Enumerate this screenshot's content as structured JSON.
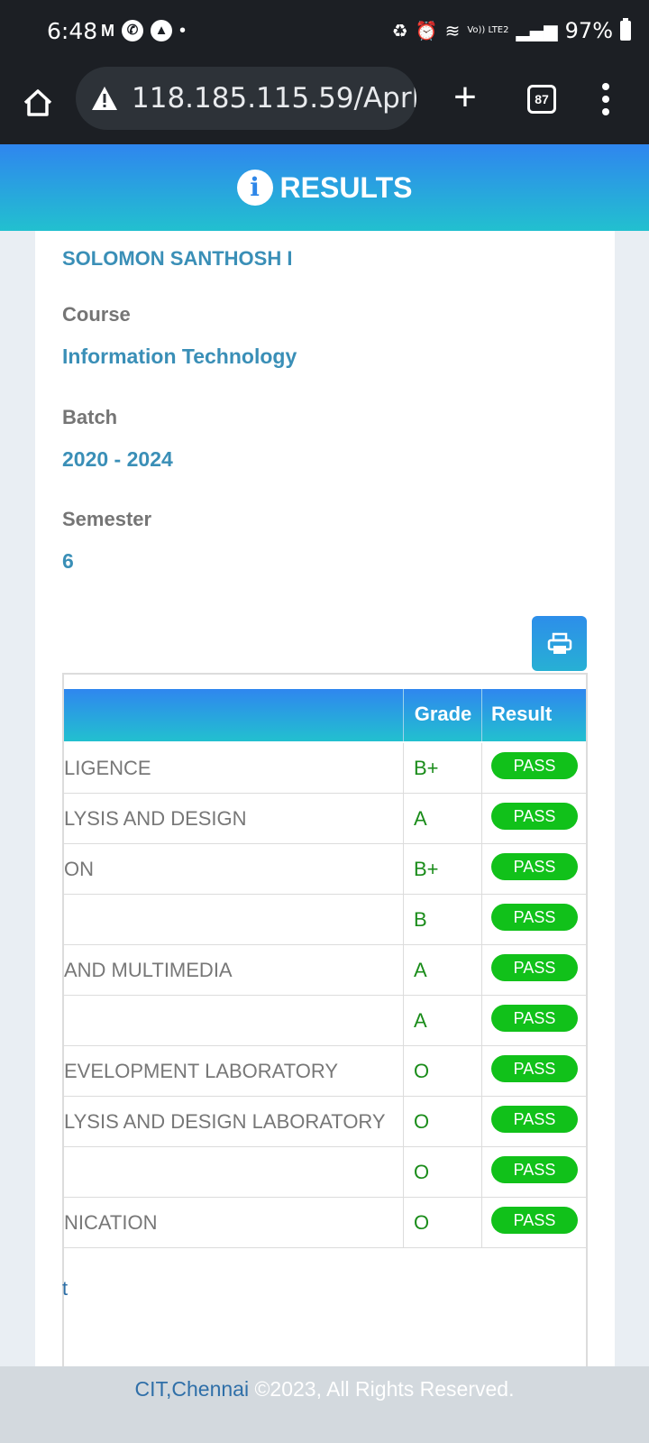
{
  "status_bar": {
    "time": "6:48",
    "battery": "97%",
    "volte": "Vo)) LTE2"
  },
  "browser": {
    "url": "118.185.115.59/AprM",
    "tab_count": "87"
  },
  "header": {
    "title": "RESULTS"
  },
  "student": {
    "name": "SOLOMON SANTHOSH I",
    "course_label": "Course",
    "course": "Information Technology",
    "batch_label": "Batch",
    "batch": "2020 - 2024",
    "semester_label": "Semester",
    "semester": "6"
  },
  "table": {
    "headers": {
      "grade": "Grade",
      "result": "Result"
    },
    "rows": [
      {
        "subject": "LIGENCE",
        "grade": "B+",
        "result": "PASS"
      },
      {
        "subject": "LYSIS AND DESIGN",
        "grade": "A",
        "result": "PASS"
      },
      {
        "subject": "ON",
        "grade": "B+",
        "result": "PASS"
      },
      {
        "subject": "",
        "grade": "B",
        "result": "PASS"
      },
      {
        "subject": "AND MULTIMEDIA",
        "grade": "A",
        "result": "PASS"
      },
      {
        "subject": "",
        "grade": "A",
        "result": "PASS"
      },
      {
        "subject": "EVELOPMENT LABORATORY",
        "grade": "O",
        "result": "PASS"
      },
      {
        "subject": "LYSIS AND DESIGN LABORATORY",
        "grade": "O",
        "result": "PASS"
      },
      {
        "subject": "",
        "grade": "O",
        "result": "PASS"
      },
      {
        "subject": "NICATION",
        "grade": "O",
        "result": "PASS"
      }
    ]
  },
  "partial_link": "t",
  "footer": {
    "org": "CIT,Chennai",
    "copyright": " ©2023, All Rights Reserved."
  }
}
